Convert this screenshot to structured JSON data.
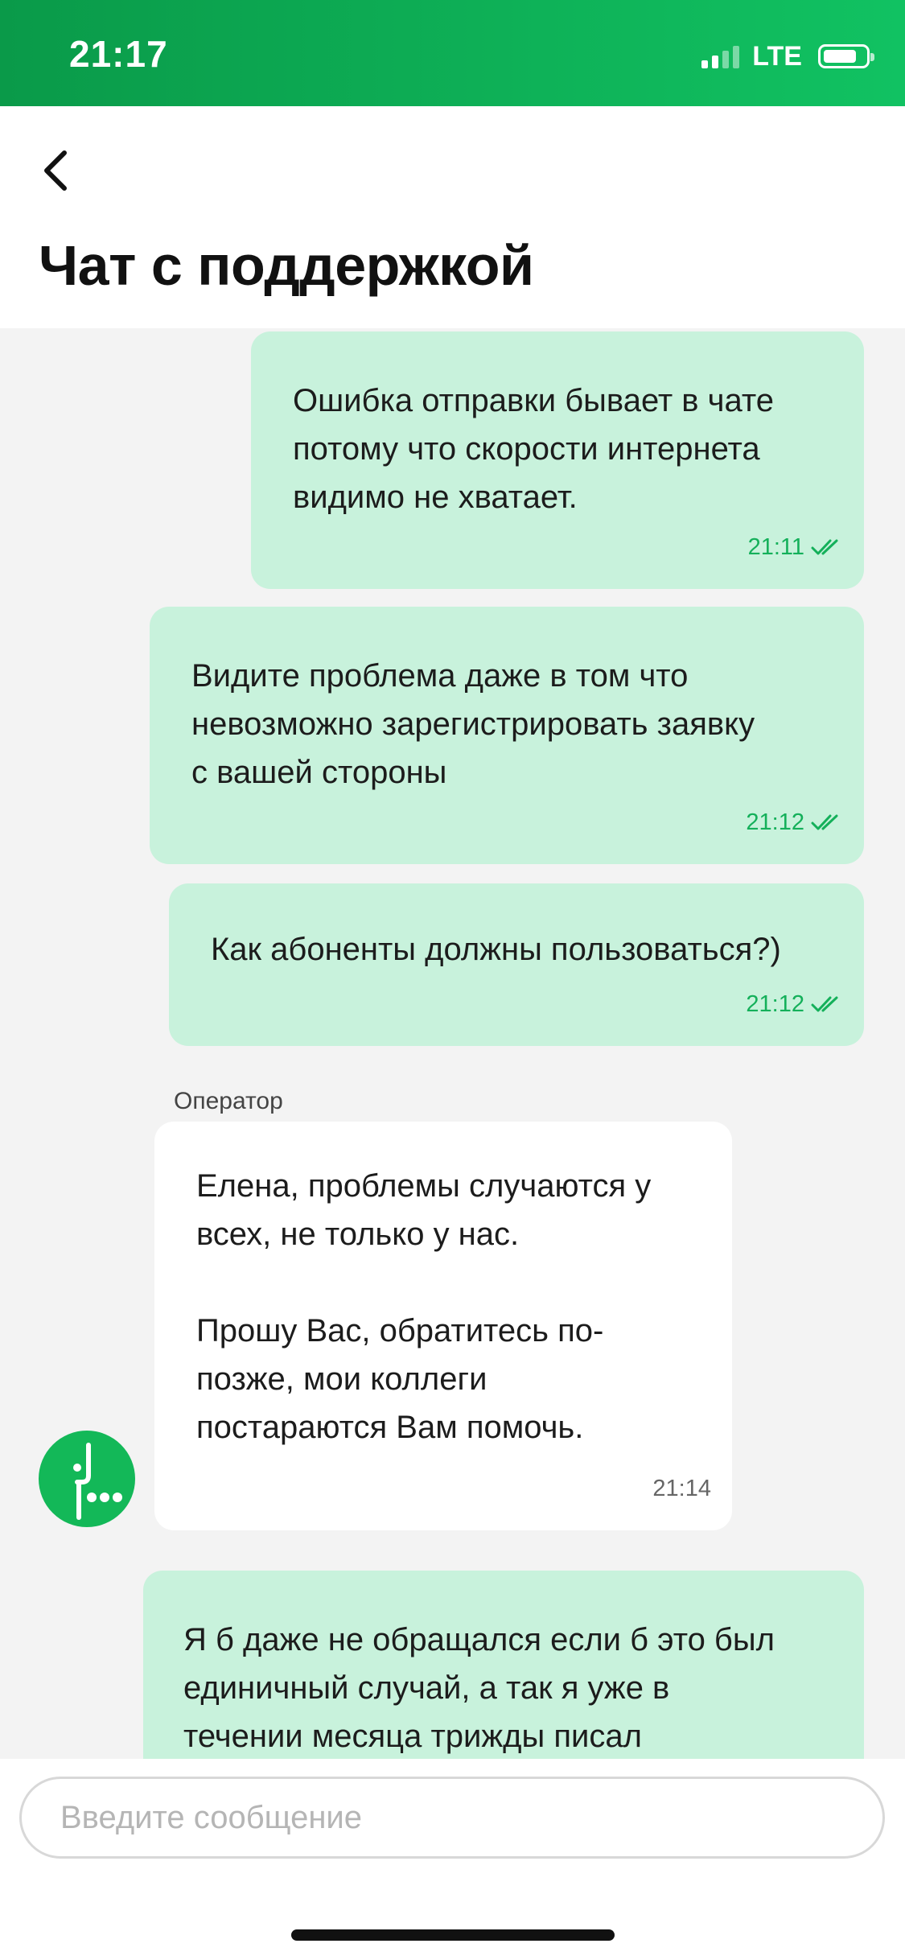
{
  "status_bar": {
    "time": "21:17",
    "network": "LTE"
  },
  "header": {
    "title": "Чат с поддержкой",
    "back_icon": "chevron-left-icon"
  },
  "messages": [
    {
      "direction": "outgoing",
      "text": "Ошибка отправки бывает в чате\nпотому что скорости интернета\nвидимо не хватает.",
      "time": "21:11",
      "status_icon": "double-check-icon"
    },
    {
      "direction": "outgoing",
      "text": "Видите проблема даже в том что\nневозможно зарегистрировать заявку\nс вашей стороны",
      "time": "21:12",
      "status_icon": "double-check-icon"
    },
    {
      "direction": "outgoing",
      "text": "Как абоненты должны пользоваться?)",
      "time": "21:12",
      "status_icon": "double-check-icon"
    },
    {
      "direction": "incoming",
      "sender": "Оператор",
      "text": "Елена, проблемы случаются у\nвсех, не только у нас.\n\nПрошу Вас, обратитесь по-\nпозже, мои коллеги\nпостараются Вам помочь.",
      "time": "21:14"
    },
    {
      "direction": "outgoing",
      "text": "Я б даже не обращался если б это был\nединичный случай, а так я уже в\nтечении месяца трижды писал"
    }
  ],
  "composer": {
    "placeholder": "Введите сообщение"
  },
  "colors": {
    "brand_green": "#13b858",
    "outgoing_bubble": "#c8f2dc",
    "incoming_bubble": "#ffffff",
    "check_green": "#14b05a"
  }
}
